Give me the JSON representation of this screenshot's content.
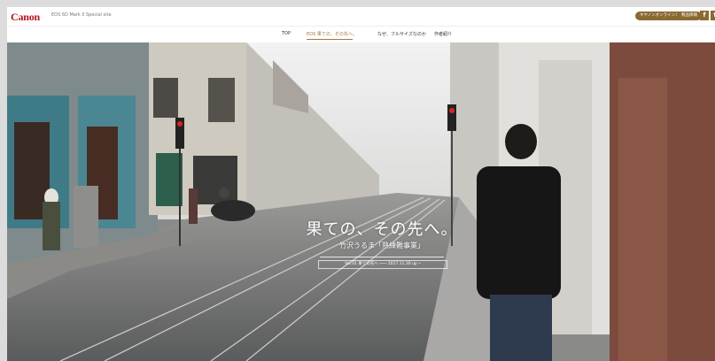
{
  "header": {
    "logo": "Canon",
    "subtitle": "EOS 6D Mark II Special site",
    "btn_online_shop": "キヤノンオンラインショップ",
    "btn_products": "製品情報",
    "social_facebook": "f",
    "social_twitter": "t"
  },
  "nav": {
    "items": [
      "TOP",
      "EOS 果ての、その先へ。",
      "なぜ、フルサイズなのか",
      "作者紹介"
    ]
  },
  "hero": {
    "title": "果ての、その先へ。",
    "subtitle": "竹沢うるま「熟練難事業」",
    "volume": "Vol.01 果ての先へ ─── 2017.11.30 up ─"
  },
  "colors": {
    "brand": "#b5121b",
    "accent": "#a0783e",
    "button": "#8a6a32"
  }
}
